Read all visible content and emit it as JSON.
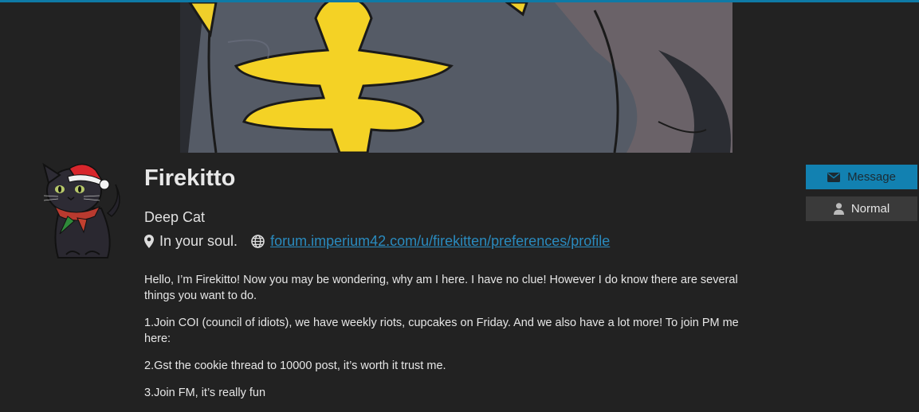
{
  "profile": {
    "username": "Firekitto",
    "title": "Deep Cat",
    "location": "In your soul.",
    "website": "forum.imperium42.com/u/firekitten/preferences/profile"
  },
  "actions": {
    "message_label": "Message",
    "normal_label": "Normal"
  },
  "bio": {
    "paragraphs": [
      "Hello, I’m Firekitto! Now you may be wondering, why am I here. I have no clue! However I do know there are several things you want to do.",
      "1.Join COI (council of idiots), we have weekly riots, cupcakes on Friday. And we also have a lot more! To join PM me here:",
      "2.Gst the cookie thread to 10000 post, it’s worth it trust me.",
      "3.Join FM, it’s really fun"
    ]
  },
  "colors": {
    "accent": "#1281b1",
    "link": "#2a8bbf",
    "background": "#222222",
    "secondary_button": "#3a3a3a"
  },
  "icons": [
    "map-marker-icon",
    "globe-icon",
    "envelope-icon",
    "user-icon"
  ]
}
